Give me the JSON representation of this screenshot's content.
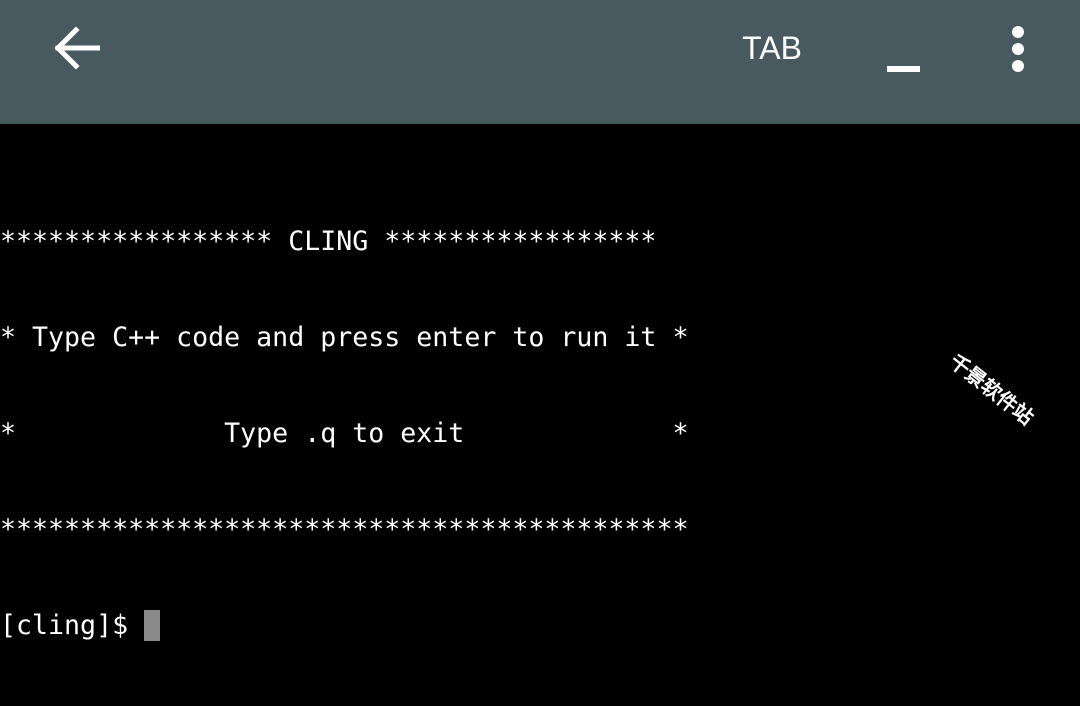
{
  "toolbar": {
    "back_icon": "arrow-left-icon",
    "tab_label": "TAB",
    "minimize_icon": "underscore-icon",
    "more_icon": "vertical-dots-icon",
    "background_color": "#48595f"
  },
  "terminal": {
    "background_color": "#000000",
    "text_color": "#ffffff",
    "lines": [
      "***************** CLING *****************",
      "* Type C++ code and press enter to run it *",
      "*             Type .q to exit             *",
      "*******************************************"
    ],
    "prompt": "[cling]$",
    "cursor_color": "#8a8a8a"
  },
  "watermark": {
    "text": "千景软件站"
  }
}
